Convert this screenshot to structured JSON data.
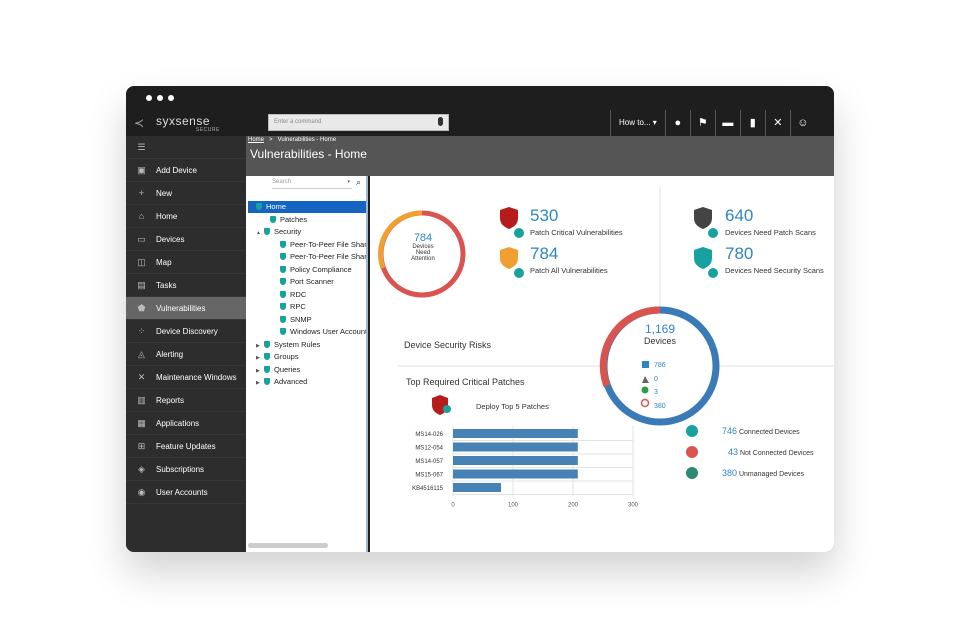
{
  "window": {
    "title": "Vulnerabilities - Home"
  },
  "brand": {
    "name": "syxsense",
    "sub": "SECURE"
  },
  "command": {
    "placeholder": "Enter a command"
  },
  "toolbar": {
    "howto": "How to... ▾"
  },
  "breadcrumb": {
    "home": "Home",
    "sep": ">",
    "current": "Vulnerabilities - Home"
  },
  "sidebar": {
    "items": [
      {
        "label": "",
        "icon": "menu-icon"
      },
      {
        "label": "Add Device",
        "icon": "add-device-icon"
      },
      {
        "label": "New",
        "icon": "plus-icon"
      },
      {
        "label": "Home",
        "icon": "home-icon"
      },
      {
        "label": "Devices",
        "icon": "monitor-icon"
      },
      {
        "label": "Map",
        "icon": "map-icon"
      },
      {
        "label": "Tasks",
        "icon": "tasks-icon"
      },
      {
        "label": "Vulnerabilities",
        "icon": "shield-icon"
      },
      {
        "label": "Device Discovery",
        "icon": "discovery-icon"
      },
      {
        "label": "Alerting",
        "icon": "bell-icon"
      },
      {
        "label": "Maintenance Windows",
        "icon": "tools-icon"
      },
      {
        "label": "Reports",
        "icon": "chart-icon"
      },
      {
        "label": "Applications",
        "icon": "applications-icon"
      },
      {
        "label": "Feature Updates",
        "icon": "windows-icon"
      },
      {
        "label": "Subscriptions",
        "icon": "tag-icon"
      },
      {
        "label": "User Accounts",
        "icon": "users-icon"
      }
    ]
  },
  "tree": {
    "search_placeholder": "Search",
    "nodes": [
      {
        "label": "Home"
      },
      {
        "label": "Patches"
      },
      {
        "label": "Security"
      },
      {
        "label": "Peer-To-Peer File Shar"
      },
      {
        "label": "Peer-To-Peer File Shar"
      },
      {
        "label": "Policy Compliance"
      },
      {
        "label": "Port Scanner"
      },
      {
        "label": "RDC"
      },
      {
        "label": "RPC"
      },
      {
        "label": "SNMP"
      },
      {
        "label": "Windows User Account"
      },
      {
        "label": "System Rules"
      },
      {
        "label": "Groups"
      },
      {
        "label": "Queries"
      },
      {
        "label": "Advanced"
      }
    ]
  },
  "summary": {
    "ring_value": "784",
    "ring_line1": "Devices",
    "ring_line2": "Need",
    "ring_line3": "Attention",
    "critical_value": "530",
    "critical_label": "Patch Critical Vulnerabilities",
    "all_value": "784",
    "all_label": "Patch All Vulnerabilities",
    "scans_value": "640",
    "scans_label": "Devices Need Patch Scans",
    "secscans_value": "780",
    "secscans_label": "Devices Need Security Scans"
  },
  "risks": {
    "title": "Device Security Risks"
  },
  "devices": {
    "total": "1,169",
    "label": "Devices",
    "windows": "786",
    "linux": "0",
    "mac": "3",
    "unknown": "380",
    "connected_value": "746",
    "connected_label": "Connected Devices",
    "notconnected_value": "43",
    "notconnected_label": "Not Connected Devices",
    "unmanaged_value": "380",
    "unmanaged_label": "Unmanaged Devices"
  },
  "patches": {
    "title": "Top Required Critical Patches",
    "deploy": "Deploy Top 5 Patches"
  },
  "colors": {
    "accent": "#2e86c1",
    "ring_red": "#d9534f",
    "ring_orange": "#f0a030",
    "bar": "#4682b4",
    "teal": "#17a2a0",
    "dark": "#1e1e1e"
  },
  "chart_data": {
    "type": "bar",
    "orientation": "horizontal",
    "categories": [
      "MS14-026",
      "MS12-054",
      "MS14-057",
      "MS15-067",
      "KB4516115"
    ],
    "values": [
      208,
      208,
      208,
      208,
      80
    ],
    "xlim": [
      0,
      300
    ],
    "xticks": [
      "0",
      "100",
      "200",
      "300"
    ],
    "grid": true,
    "title": "",
    "xlabel": "",
    "ylabel": ""
  }
}
